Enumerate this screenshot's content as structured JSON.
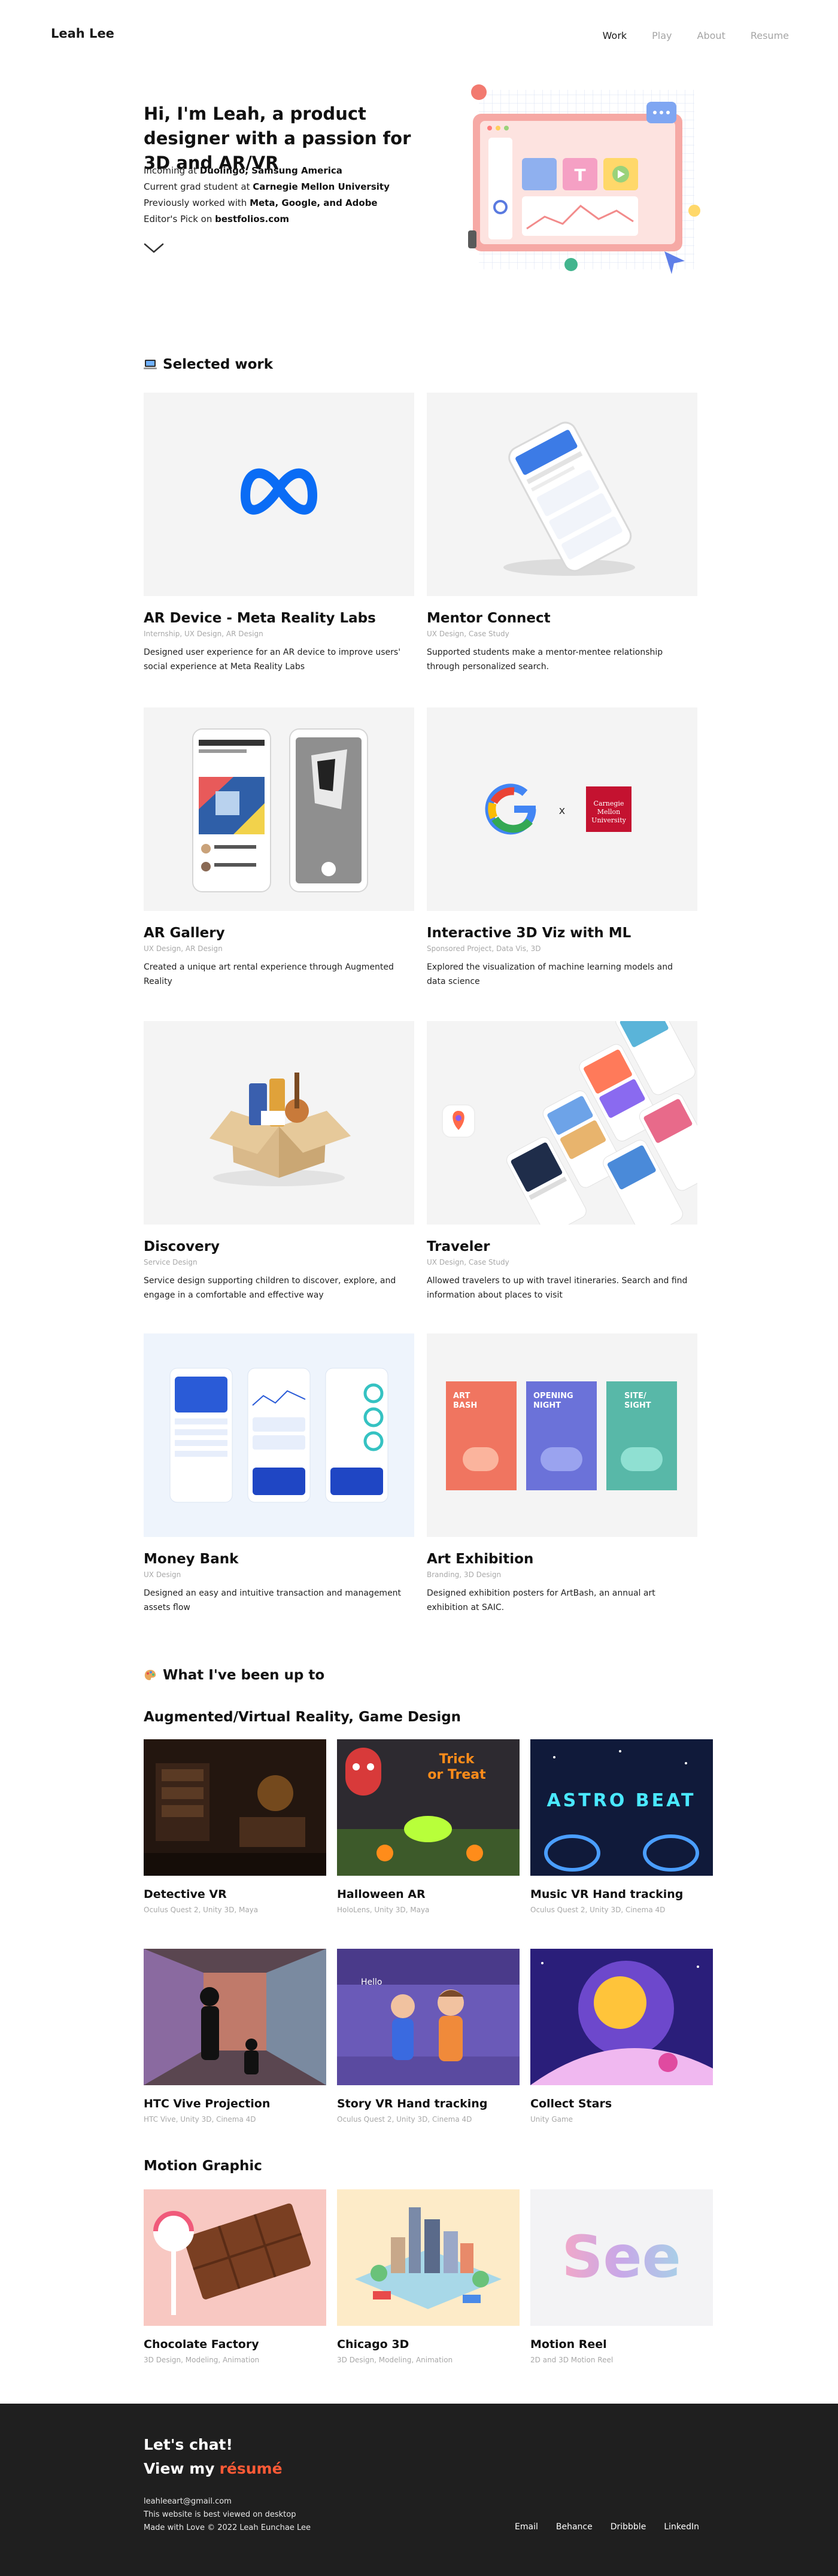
{
  "nav": {
    "brand": "Leah Lee",
    "links": [
      "Work",
      "Play",
      "About",
      "Resume"
    ]
  },
  "hero": {
    "title": "Hi, I'm Leah, a product designer with a passion for 3D and AR/VR",
    "line1_pre": "Incoming at ",
    "line1_bold": "Duolingo, Samsung America",
    "line2_pre": "Current grad student at ",
    "line2_bold": "Carnegie Mellon University",
    "line3_pre": "Previously worked with ",
    "line3_bold": "Meta, Google, and Adobe",
    "line4_pre": "Editor's Pick on ",
    "line4_bold": "bestfolios.com"
  },
  "selected_work": {
    "heading": "Selected work",
    "items": [
      {
        "title": "AR Device - Meta Reality Labs",
        "tags": "Internship, UX Design, AR Design",
        "desc": "Designed user experience for an AR device to improve users' social experience at Meta Reality Labs"
      },
      {
        "title": "Mentor Connect",
        "tags": "UX Design, Case Study",
        "desc": "Supported students make a mentor-mentee relationship through personalized search."
      },
      {
        "title": "AR Gallery",
        "tags": "UX Design, AR Design",
        "desc": "Created a unique art rental experience through Augmented Reality"
      },
      {
        "title": "Interactive 3D Viz with ML",
        "tags": "Sponsored Project, Data Vis, 3D",
        "desc": "Explored the visualization of machine learning models and data science"
      },
      {
        "title": "Discovery",
        "tags": "Service Design",
        "desc": "Service design supporting children to discover, explore, and engage in a comfortable and effective way"
      },
      {
        "title": "Traveler",
        "tags": "UX Design, Case Study",
        "desc": "Allowed travelers to up with travel itineraries. Search and find information about places to visit"
      },
      {
        "title": "Money Bank",
        "tags": "UX Design",
        "desc": "Designed an easy and intuitive transaction and management assets flow"
      },
      {
        "title": "Art Exhibition",
        "tags": "Branding, 3D Design",
        "desc": "Designed exhibition posters for ArtBash, an annual art exhibition at SAIC."
      }
    ],
    "thumb_text": {
      "cmu": "Carnegie Mellon University",
      "x_sep": "x",
      "poster1": "ART BASH",
      "poster2": "OPENING NIGHT",
      "poster3": "SITE/ SIGHT",
      "halloween": "Trick or Treat",
      "astrobeat": "ASTRO BEAT",
      "see": "See"
    }
  },
  "play": {
    "heading": "What I've been up to",
    "ar_vr_heading": "Augmented/Virtual Reality, Game Design",
    "ar_vr": [
      {
        "title": "Detective VR",
        "tags": "Oculus Quest 2, Unity 3D, Maya"
      },
      {
        "title": "Halloween AR",
        "tags": "HoloLens, Unity 3D, Maya"
      },
      {
        "title": "Music VR Hand tracking",
        "tags": "Oculus Quest 2, Unity 3D, Cinema 4D"
      },
      {
        "title": "HTC Vive Projection",
        "tags": "HTC Vive, Unity 3D, Cinema 4D"
      },
      {
        "title": "Story VR Hand tracking",
        "tags": "Oculus Quest 2, Unity 3D, Cinema 4D"
      },
      {
        "title": "Collect Stars",
        "tags": "Unity Game"
      }
    ],
    "motion_heading": "Motion Graphic",
    "motion": [
      {
        "title": "Chocolate Factory",
        "tags": "3D Design, Modeling, Animation"
      },
      {
        "title": "Chicago 3D",
        "tags": "3D Design, Modeling, Animation"
      },
      {
        "title": "Motion Reel",
        "tags": "2D and 3D Motion Reel"
      }
    ]
  },
  "footer": {
    "chat": "Let's chat!",
    "view_pre": "View my",
    "resume": "résumé",
    "email": "leahleeart@gmail.com",
    "note": "This website is best viewed on desktop",
    "made": "Made with Love © 2022 Leah Eunchae Lee",
    "links": [
      "Email",
      "Behance",
      "Dribbble",
      "LinkedIn"
    ]
  },
  "colors": {
    "accent": "#ff5a36",
    "footer_bg": "#1f1f1f",
    "muted": "#a8a8a8",
    "thumb_bg": "#f4f4f4"
  }
}
